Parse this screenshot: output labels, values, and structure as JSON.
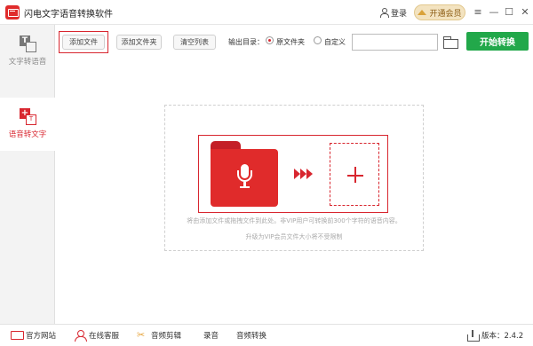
{
  "app": {
    "title": "闪电文字语音转换软件",
    "login_label": "登录",
    "vip_label": "开通会员",
    "window_controls": {
      "menu": "≡",
      "minimize": "—",
      "maximize": "☐",
      "close": "✕"
    }
  },
  "sidebar": {
    "items": [
      {
        "label": "文字转语音",
        "icon": "text-to-speech-icon",
        "active": false
      },
      {
        "label": "语音转文字",
        "icon": "speech-to-text-icon",
        "active": true
      }
    ]
  },
  "toolbar": {
    "add_file": "添加文件",
    "add_folder": "添加文件夹",
    "clear_list": "清空列表",
    "output_label": "输出目录：",
    "radio_original": "原文件夹",
    "radio_custom": "自定义",
    "selected_output": "原文件夹",
    "path_value": "",
    "start_label": "开始转换"
  },
  "drop_area": {
    "hint_line1": "将由添加文件或拖拽文件到此处。非VIP用户可转换前300个字符的语音内容。",
    "hint_line2": "升级为VIP会员文件大小将不受限制"
  },
  "statusbar": {
    "website": "官方网站",
    "support": "在线客服",
    "audio_edit": "音频剪辑",
    "record": "录音",
    "audio_convert": "音频转换",
    "version": "版本：2.4.2"
  },
  "colors": {
    "accent": "#d8262f",
    "start_button": "#22a84a",
    "vip_bg": "#f3e3c0"
  }
}
